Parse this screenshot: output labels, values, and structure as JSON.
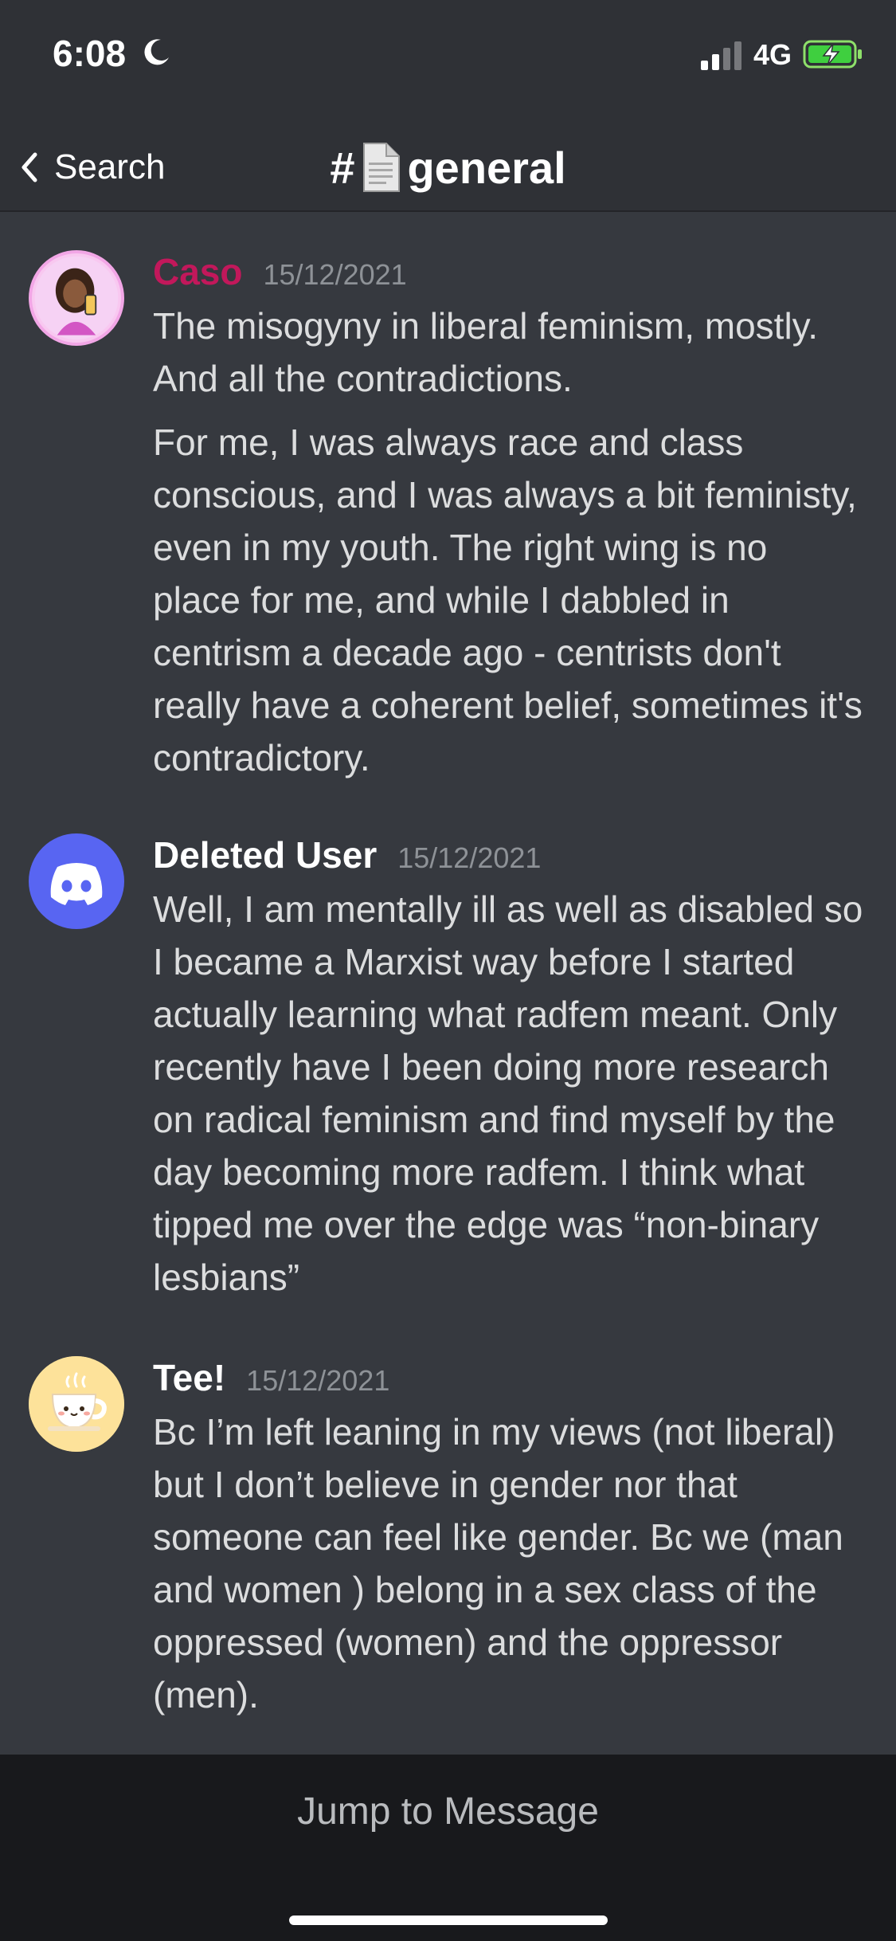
{
  "status_bar": {
    "time": "6:08",
    "network": "4G"
  },
  "nav": {
    "back_label": "Search",
    "channel_prefix": "#",
    "channel_name": "general"
  },
  "messages": [
    {
      "author": "Caso",
      "author_color": "#c2185b",
      "timestamp": "15/12/2021",
      "paragraphs": [
        "The misogyny in liberal feminism, mostly. And all the contradictions.",
        "For me, I was always race and class conscious, and I was always a bit feministy, even in my youth. The right wing is no place for me, and while I dabbled in centrism a decade ago - centrists don't really have a coherent belief, sometimes it's contradictory."
      ]
    },
    {
      "author": "Deleted User",
      "author_color": "#ffffff",
      "timestamp": "15/12/2021",
      "paragraphs": [
        "Well, I am mentally ill as well as disabled so I became a Marxist way before I started actually learning what radfem meant. Only recently have I been doing more research on radical feminism and find myself by the day becoming more radfem. I think what tipped me over the edge was “non-binary lesbians”"
      ]
    },
    {
      "author": "Tee!",
      "author_color": "#ffffff",
      "timestamp": "15/12/2021",
      "paragraphs": [
        "Bc I’m left leaning in my views (not liberal) but I don’t believe in gender nor that someone can feel like gender. Bc we (man and women ) belong in a sex class of the oppressed (women) and the oppressor (men)."
      ]
    }
  ],
  "bottom_bar": {
    "jump_label": "Jump to Message"
  },
  "colors": {
    "background": "#36393f",
    "header_bg": "#2f3136",
    "bottom_bg": "#18191c",
    "blurple": "#5865f2"
  }
}
